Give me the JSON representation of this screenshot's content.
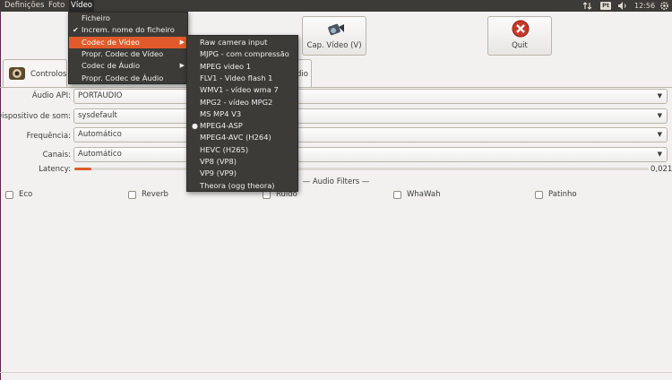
{
  "topbar": {
    "menus": [
      "Definições",
      "Foto",
      "Vídeo"
    ],
    "pt_badge": "Pt",
    "clock": "12:56"
  },
  "buttons": {
    "cap_video": "Cap. Vídeo (V)",
    "quit": "Quit"
  },
  "tabs": {
    "controls": "Controlos d",
    "audio_partial": "dio"
  },
  "audio": {
    "api_label": "Áudio API:",
    "api_value": "PORTAUDIO",
    "device_label": "Dispositivo de som:",
    "device_value": "sysdefault",
    "freq_label": "Frequência:",
    "freq_value": "Automático",
    "channels_label": "Canais:",
    "channels_value": "Automático",
    "latency_label": "Latency:",
    "latency_value": "0,021",
    "latency_fraction": 0.03
  },
  "filters": {
    "title": "— Audio Filters —",
    "items": [
      "Eco",
      "Reverb",
      "Ruído",
      "WhaWah",
      "Patinho"
    ]
  },
  "video_menu": {
    "items": [
      {
        "label": "Ficheiro",
        "checked": false,
        "submenu": false
      },
      {
        "label": "Increm. nome do ficheiro",
        "checked": true,
        "submenu": false
      },
      {
        "label": "Codec de Vídeo",
        "checked": false,
        "submenu": true
      },
      {
        "label": "Propr. Codec de Vídeo",
        "checked": false,
        "submenu": false
      },
      {
        "label": "Codec de Áudio",
        "checked": false,
        "submenu": true
      },
      {
        "label": "Propr. Codec de Áudio",
        "checked": false,
        "submenu": false
      }
    ],
    "highlighted": "Codec de Vídeo"
  },
  "codec_menu": {
    "items": [
      "Raw camera input",
      "MJPG - com compressão",
      "MPEG video 1",
      "FLV1 - Video flash 1",
      "WMV1 - vídeo wma 7",
      "MPG2 - vídeo MPG2",
      "MS MP4 V3",
      "MPEG4-ASP",
      "MPEG4-AVC (H264)",
      "HEVC (H265)",
      "VP8 (VP8)",
      "VP9 (VP9)",
      "Theora (ogg theora)"
    ],
    "selected": "MPEG4-ASP"
  },
  "colors": {
    "accent": "#e05a2b",
    "panel": "#3c3b37",
    "window": "#f2f1f0"
  }
}
